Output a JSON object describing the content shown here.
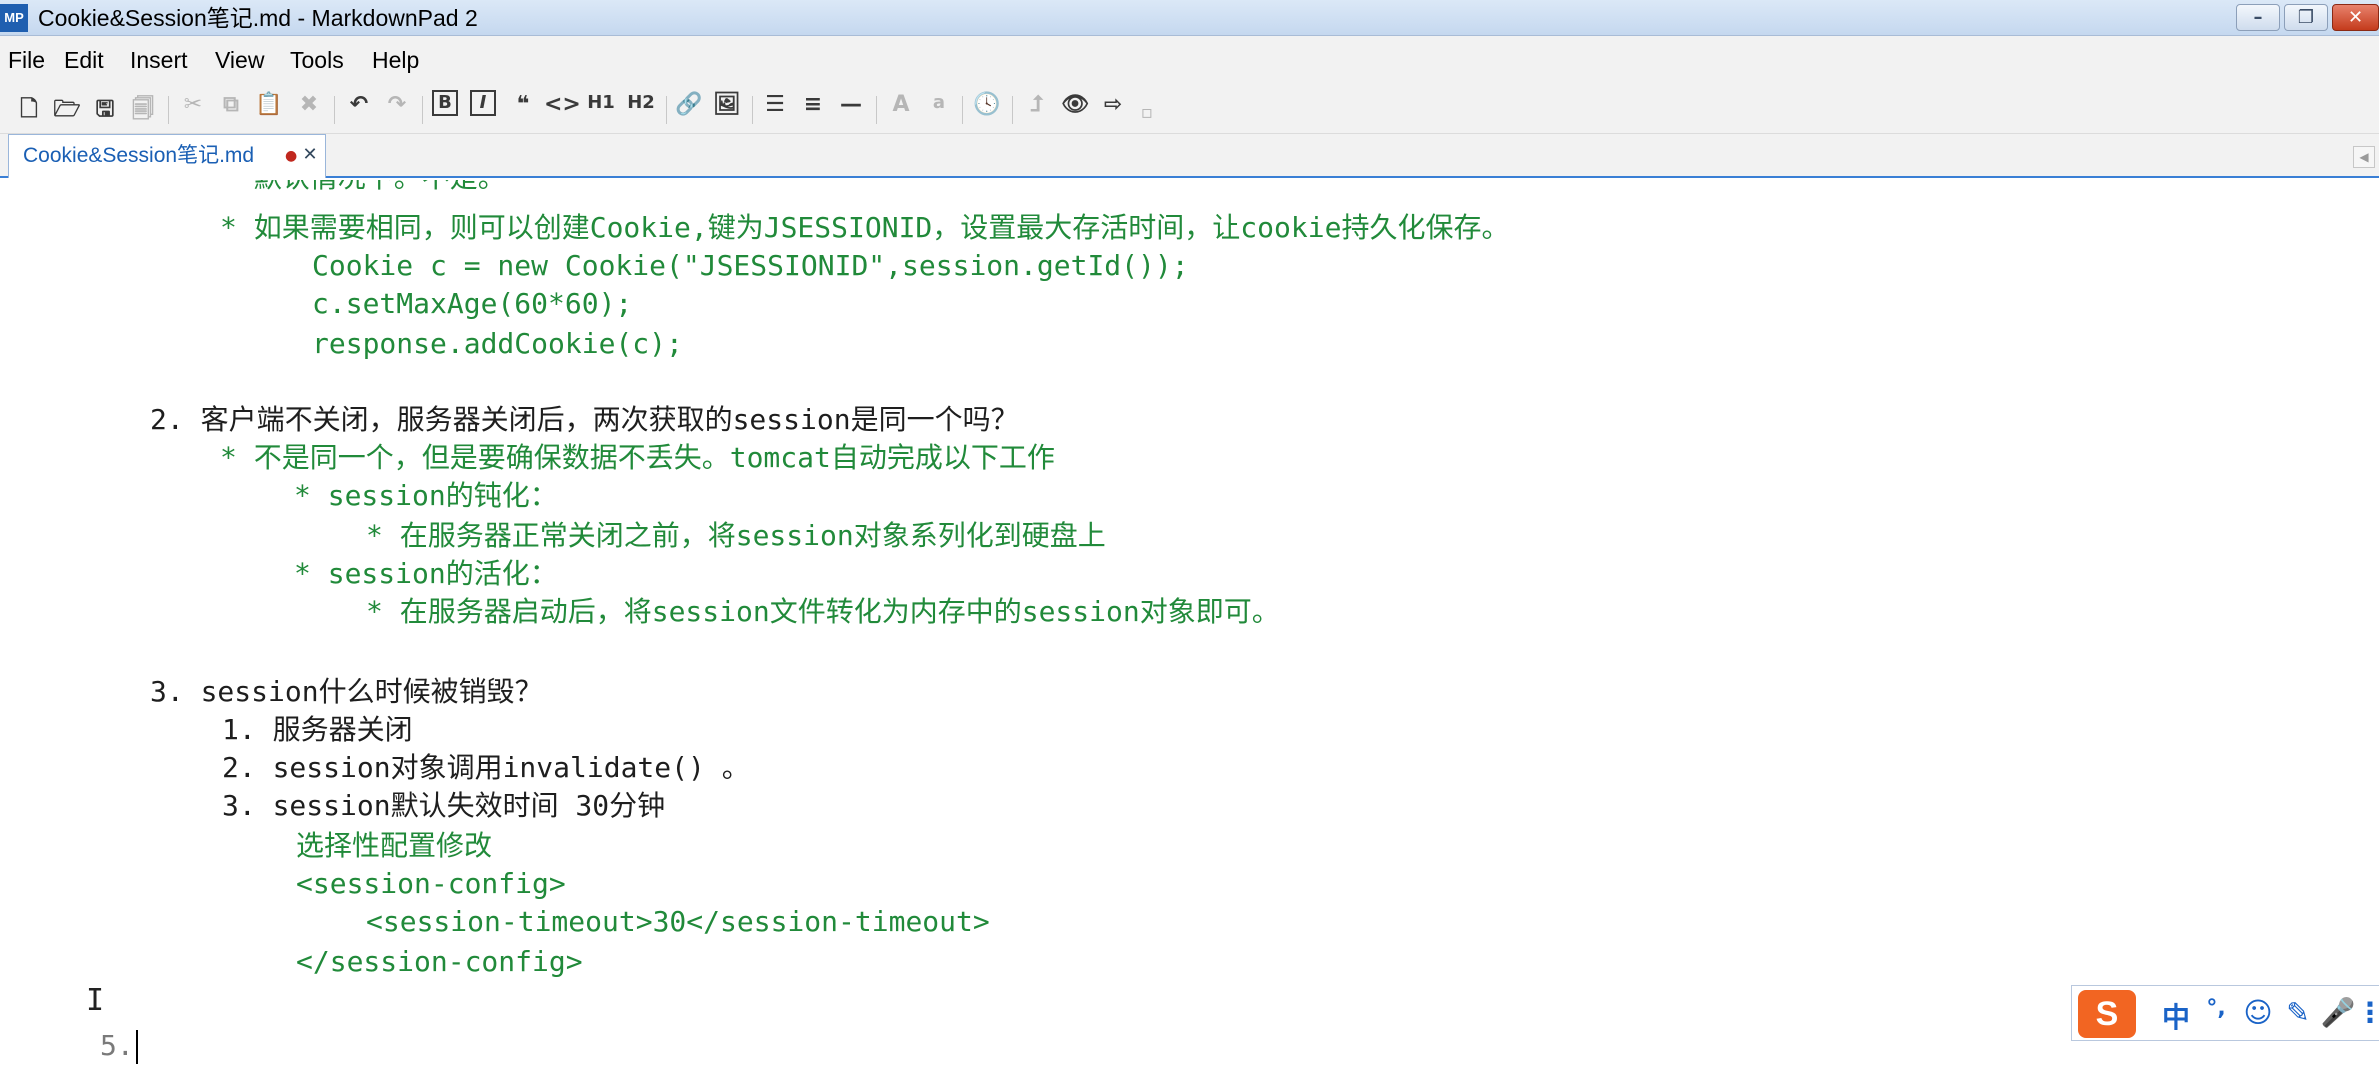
{
  "window": {
    "app_icon": "MP",
    "title": "Cookie&Session笔记.md - MarkdownPad 2",
    "controls": {
      "minimize": "minimize-icon",
      "maximize": "restore-icon",
      "close": "close-icon"
    }
  },
  "menu": [
    "File",
    "Edit",
    "Insert",
    "View",
    "Tools",
    "Help"
  ],
  "toolbar": {
    "icons": [
      "new-document-icon",
      "open-folder-icon",
      "save-icon",
      "save-all-icon",
      "cut-icon",
      "copy-icon",
      "paste-icon",
      "delete-icon",
      "undo-icon",
      "redo-icon",
      "bold-icon",
      "italic-icon",
      "quote-icon",
      "code-icon",
      "heading1-icon",
      "heading2-icon",
      "link-icon",
      "image-icon",
      "unordered-list-icon",
      "ordered-list-icon",
      "horizontal-rule-icon",
      "uppercase-icon",
      "lowercase-icon",
      "timestamp-icon",
      "export-icon",
      "preview-icon",
      "publish-icon"
    ],
    "labels": {
      "h1": "H1",
      "h2": "H2",
      "bold": "B",
      "italic": "I",
      "uppercase": "A",
      "lowercase": "a"
    }
  },
  "tab": {
    "label": "Cookie&Session笔记.md",
    "unsaved_marker": "●",
    "close": "✕"
  },
  "editor": {
    "lines": [
      "* 如果需要相同，则可以创建Cookie,键为JSESSIONID，设置最大存活时间，让cookie持久化保存。",
      "Cookie c = new Cookie(\"JSESSIONID\",session.getId());",
      "c.setMaxAge(60*60);",
      "response.addCookie(c);",
      "2. 客户端不关闭，服务器关闭后，两次获取的session是同一个吗？",
      "* 不是同一个，但是要确保数据不丢失。tomcat自动完成以下工作",
      "* session的钝化：",
      "* 在服务器正常关闭之前，将session对象系列化到硬盘上",
      "* session的活化：",
      "* 在服务器启动后，将session文件转化为内存中的session对象即可。",
      "3. session什么时候被销毁？",
      "1. 服务器关闭",
      "2. session对象调用invalidate() 。",
      "3. session默认失效时间 30分钟",
      "选择性配置修改",
      "<session-config>",
      "<session-timeout>30</session-timeout>",
      "</session-config>",
      "5."
    ]
  },
  "ime": {
    "logo": "S",
    "mode": "中",
    "punct": "°,",
    "emoji": "emoji-icon",
    "skin": "pen-icon",
    "voice": "mic-icon"
  },
  "colors": {
    "text_green": "#218a3a",
    "text_black": "#1e1e1e",
    "tab_accent": "#3a7fd5",
    "ime_orange": "#f26522"
  }
}
